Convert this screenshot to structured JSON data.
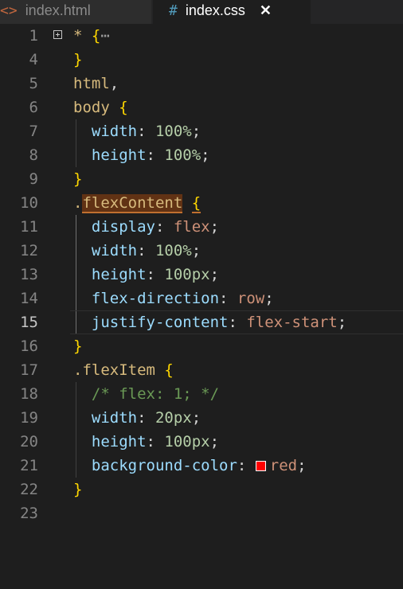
{
  "tabs": [
    {
      "icon": "<>",
      "label": "index.html",
      "active": false
    },
    {
      "icon": "#",
      "label": "index.css",
      "active": true,
      "close": "✕"
    }
  ],
  "lines": [
    {
      "n": "1",
      "t": [
        [
          "* ",
          "star"
        ],
        [
          "{",
          "br"
        ],
        [
          "⋯",
          "dots"
        ]
      ]
    },
    {
      "n": "4",
      "t": [
        [
          "}",
          "br"
        ]
      ]
    },
    {
      "n": "5",
      "t": [
        [
          "html",
          "tag"
        ],
        [
          ",",
          "pun"
        ]
      ]
    },
    {
      "n": "6",
      "t": [
        [
          "body ",
          "tag"
        ],
        [
          "{",
          "br"
        ]
      ]
    },
    {
      "n": "7",
      "t": [
        [
          "  width",
          "prop"
        ],
        [
          ": ",
          "pun"
        ],
        [
          "100%",
          "num"
        ],
        [
          ";",
          "pun"
        ]
      ]
    },
    {
      "n": "8",
      "t": [
        [
          "  height",
          "prop"
        ],
        [
          ": ",
          "pun"
        ],
        [
          "100%",
          "num"
        ],
        [
          ";",
          "pun"
        ]
      ]
    },
    {
      "n": "9",
      "t": [
        [
          "}",
          "br"
        ]
      ]
    },
    {
      "n": "10",
      "t": [
        [
          ".",
          "sel"
        ],
        [
          "flexContent",
          "sel hl"
        ],
        [
          " ",
          "pun"
        ],
        [
          "{",
          "br hlb"
        ]
      ]
    },
    {
      "n": "11",
      "t": [
        [
          "  display",
          "prop"
        ],
        [
          ": ",
          "pun"
        ],
        [
          "flex",
          "val"
        ],
        [
          ";",
          "pun"
        ]
      ]
    },
    {
      "n": "12",
      "t": [
        [
          "  width",
          "prop"
        ],
        [
          ": ",
          "pun"
        ],
        [
          "100%",
          "num"
        ],
        [
          ";",
          "pun"
        ]
      ]
    },
    {
      "n": "13",
      "t": [
        [
          "  height",
          "prop"
        ],
        [
          ": ",
          "pun"
        ],
        [
          "100px",
          "num"
        ],
        [
          ";",
          "pun"
        ]
      ]
    },
    {
      "n": "14",
      "t": [
        [
          "  flex-direction",
          "prop"
        ],
        [
          ": ",
          "pun"
        ],
        [
          "row",
          "val"
        ],
        [
          ";",
          "pun"
        ]
      ]
    },
    {
      "n": "15",
      "t": [
        [
          "  justify-content",
          "prop"
        ],
        [
          ": ",
          "pun"
        ],
        [
          "flex-start",
          "val"
        ],
        [
          ";",
          "pun"
        ]
      ],
      "current": true
    },
    {
      "n": "16",
      "t": [
        [
          "}",
          "br"
        ]
      ]
    },
    {
      "n": "17",
      "t": [
        [
          ".flexItem ",
          "sel"
        ],
        [
          "{",
          "br"
        ]
      ]
    },
    {
      "n": "18",
      "t": [
        [
          "  /* flex: 1; */",
          "cmt"
        ]
      ]
    },
    {
      "n": "19",
      "t": [
        [
          "  width",
          "prop"
        ],
        [
          ": ",
          "pun"
        ],
        [
          "20px",
          "num"
        ],
        [
          ";",
          "pun"
        ]
      ]
    },
    {
      "n": "20",
      "t": [
        [
          "  height",
          "prop"
        ],
        [
          ": ",
          "pun"
        ],
        [
          "100px",
          "num"
        ],
        [
          ";",
          "pun"
        ]
      ]
    },
    {
      "n": "21",
      "t": [
        [
          "  background-color",
          "prop"
        ],
        [
          ": ",
          "pun"
        ],
        [
          "#SWATCH#",
          "swatch"
        ],
        [
          "red",
          "val"
        ],
        [
          ";",
          "pun"
        ]
      ]
    },
    {
      "n": "22",
      "t": [
        [
          "}",
          "br"
        ]
      ]
    },
    {
      "n": "23",
      "t": []
    }
  ],
  "colors": {
    "background": "#1e1e1e",
    "property": "#9cdcfe",
    "number": "#b5cea8",
    "value": "#ce9178",
    "selector": "#d7ba7d",
    "bracket": "#ffd700",
    "comment": "#6a9955",
    "swatch": "#ff0000"
  }
}
